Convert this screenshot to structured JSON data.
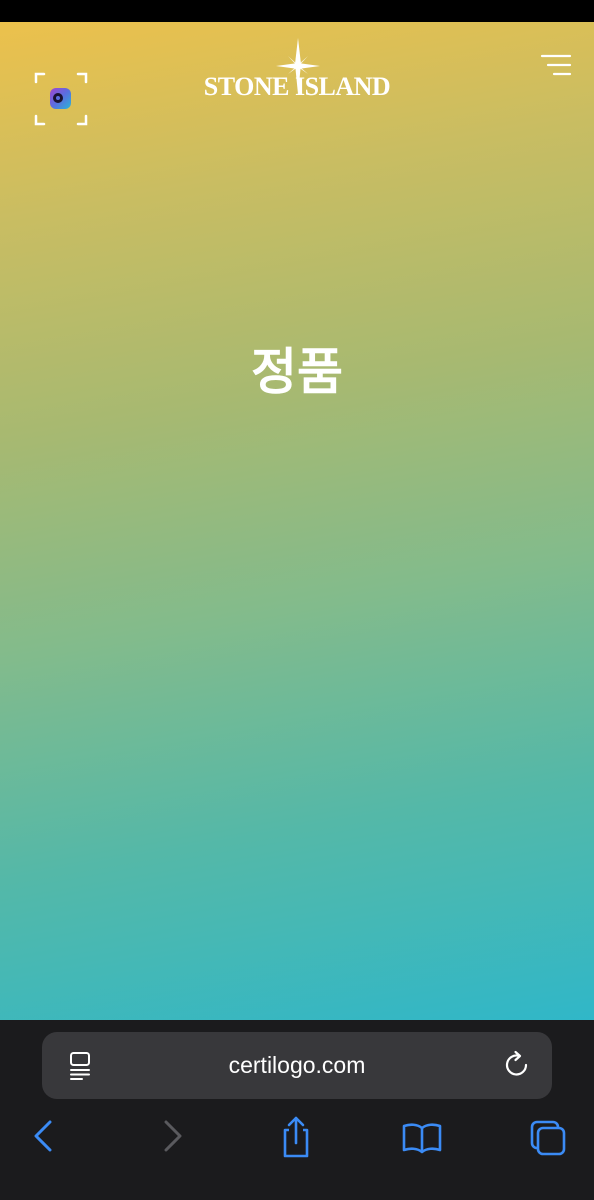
{
  "colors": {
    "gradient_top": "#ecc14c",
    "gradient_bottom": "#30b7c8",
    "toolbar_bg": "#1b1b1d",
    "address_bar_bg": "#38383b",
    "accent_blue": "#3b8bf5",
    "disabled_gray": "#5a5a5e"
  },
  "header": {
    "brand": "STONE ISLAND",
    "camera_icon": "camera-scan-icon",
    "menu_icon": "hamburger-menu-icon",
    "logo_icon": "compass-star-icon"
  },
  "main": {
    "headline": "정품"
  },
  "browser": {
    "url": "certilogo.com",
    "reader_icon": "reader-mode-icon",
    "reload_icon": "reload-icon",
    "nav": [
      {
        "name": "back",
        "icon": "chevron-left-icon",
        "enabled": true
      },
      {
        "name": "forward",
        "icon": "chevron-right-icon",
        "enabled": false
      },
      {
        "name": "share",
        "icon": "share-icon",
        "enabled": true
      },
      {
        "name": "bookmarks",
        "icon": "book-icon",
        "enabled": true
      },
      {
        "name": "tabs",
        "icon": "tabs-icon",
        "enabled": true
      }
    ]
  }
}
